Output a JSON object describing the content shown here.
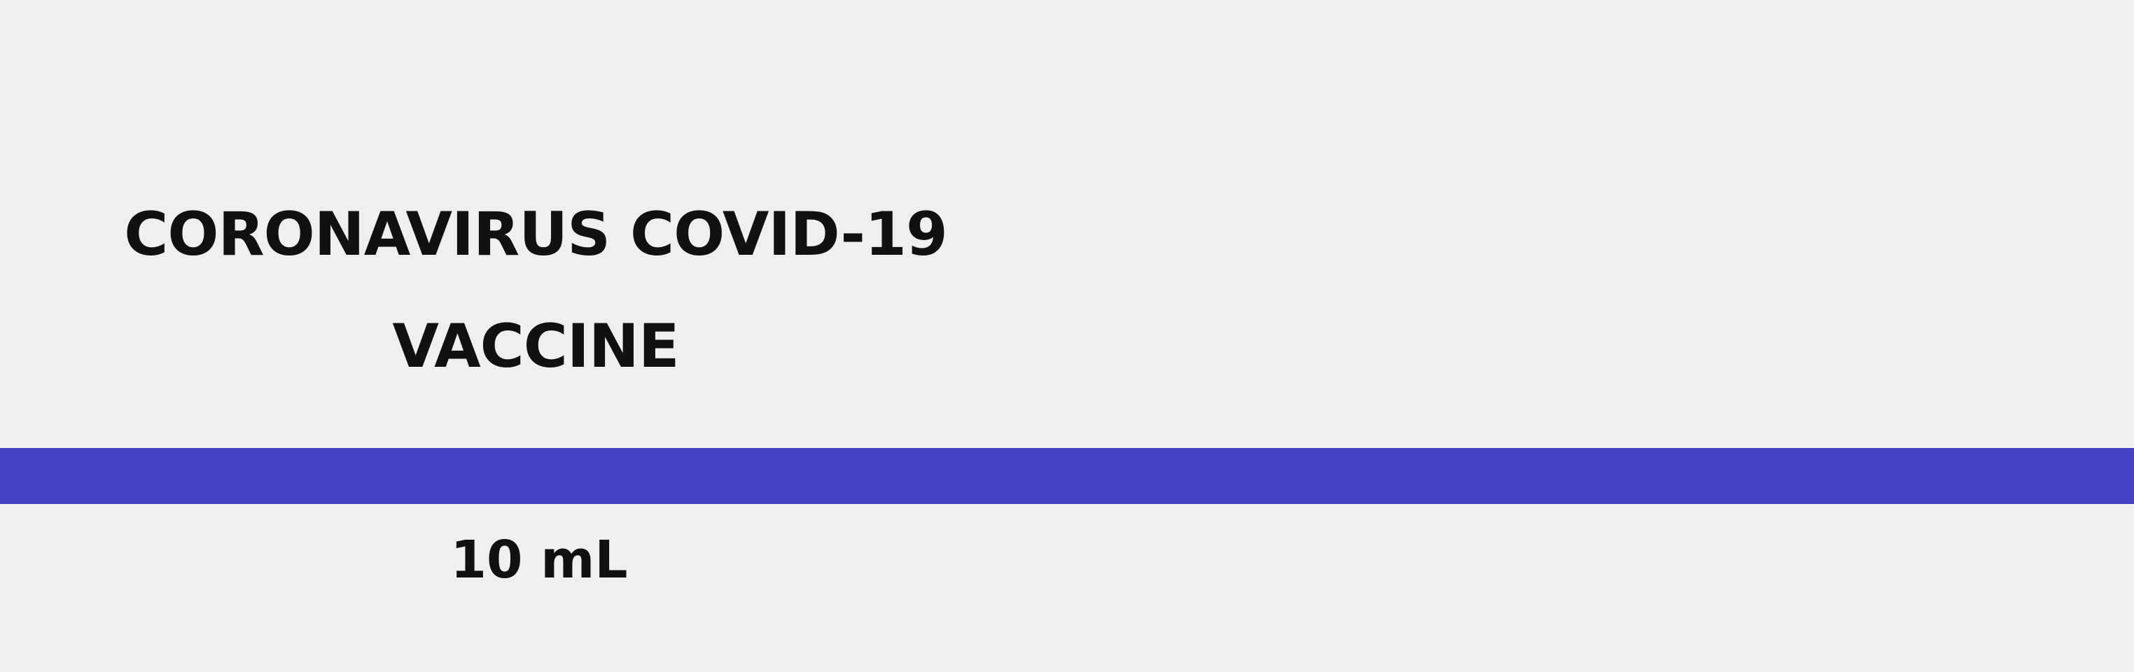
{
  "label": {
    "title_line_1": "CORONAVIRUS COVID-19",
    "title_line_2": "VACCINE",
    "volume": "10 mL"
  },
  "colors": {
    "background": "#efefef",
    "text": "#111111",
    "band": "#4242c0"
  }
}
